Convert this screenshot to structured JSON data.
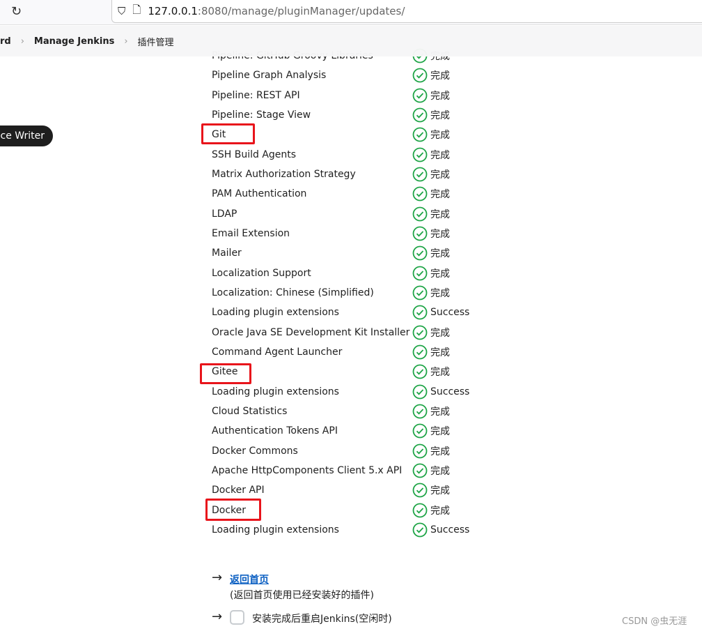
{
  "browser": {
    "url_host": "127.0.0.1",
    "url_path": ":8080/manage/pluginManager/updates/"
  },
  "breadcrumb": [
    "rd",
    "Manage Jenkins",
    "插件管理"
  ],
  "tooltip": "ice Writer",
  "plugins": [
    {
      "name": "Pipeline: GitHub Groovy Libraries",
      "status": "完成"
    },
    {
      "name": "Pipeline Graph Analysis",
      "status": "完成"
    },
    {
      "name": "Pipeline: REST API",
      "status": "完成"
    },
    {
      "name": "Pipeline: Stage View",
      "status": "完成"
    },
    {
      "name": "Git",
      "status": "完成",
      "highlighted": true
    },
    {
      "name": "SSH Build Agents",
      "status": "完成"
    },
    {
      "name": "Matrix Authorization Strategy",
      "status": "完成"
    },
    {
      "name": "PAM Authentication",
      "status": "完成"
    },
    {
      "name": "LDAP",
      "status": "完成"
    },
    {
      "name": "Email Extension",
      "status": "完成"
    },
    {
      "name": "Mailer",
      "status": "完成"
    },
    {
      "name": "Localization Support",
      "status": "完成"
    },
    {
      "name": "Localization: Chinese (Simplified)",
      "status": "完成"
    },
    {
      "name": "Loading plugin extensions",
      "status": "Success"
    },
    {
      "name": "Oracle Java SE Development Kit Installer",
      "status": "完成"
    },
    {
      "name": "Command Agent Launcher",
      "status": "完成"
    },
    {
      "name": "Gitee",
      "status": "完成",
      "highlighted": true
    },
    {
      "name": "Loading plugin extensions",
      "status": "Success"
    },
    {
      "name": "Cloud Statistics",
      "status": "完成"
    },
    {
      "name": "Authentication Tokens API",
      "status": "完成"
    },
    {
      "name": "Docker Commons",
      "status": "完成"
    },
    {
      "name": "Apache HttpComponents Client 5.x API",
      "status": "完成"
    },
    {
      "name": "Docker API",
      "status": "完成"
    },
    {
      "name": "Docker",
      "status": "完成",
      "highlighted": true
    },
    {
      "name": "Loading plugin extensions",
      "status": "Success"
    }
  ],
  "footer": {
    "home_link": "返回首页",
    "home_note": "(返回首页使用已经安装好的插件)",
    "restart_label": "安装完成后重启Jenkins(空闲时)",
    "restart_checked": false
  },
  "watermark": "CSDN @虫无涯",
  "colors": {
    "success": "#1ea446",
    "highlight": "#e8141b",
    "link": "#0b5fc2"
  }
}
